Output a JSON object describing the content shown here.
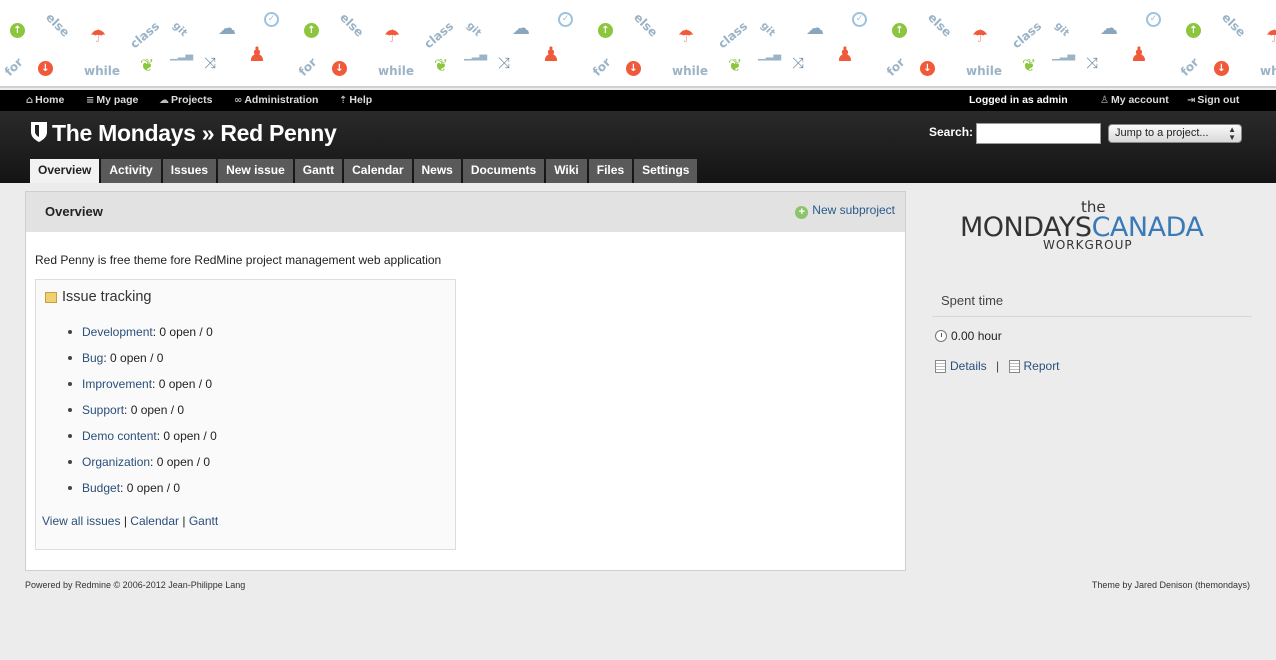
{
  "top_menu": {
    "items": [
      {
        "label": "Home",
        "icon": "home-icon"
      },
      {
        "label": "My page",
        "icon": "list-icon"
      },
      {
        "label": "Projects",
        "icon": "cloud-icon"
      },
      {
        "label": "Administration",
        "icon": "link-icon"
      },
      {
        "label": "Help",
        "icon": "help-icon"
      }
    ],
    "logged_in_prefix": "Logged in as",
    "logged_in_user": "admin",
    "my_account": "My account",
    "sign_out": "Sign out"
  },
  "pattern": {
    "words": [
      "else",
      "class",
      "git",
      "while",
      "for"
    ]
  },
  "header": {
    "title": "The Mondays » Red Penny",
    "search_label": "Search:",
    "search_value": "",
    "jump_label": "Jump to a project..."
  },
  "tabs": [
    {
      "label": "Overview",
      "selected": true
    },
    {
      "label": "Activity"
    },
    {
      "label": "Issues"
    },
    {
      "label": "New issue"
    },
    {
      "label": "Gantt"
    },
    {
      "label": "Calendar"
    },
    {
      "label": "News"
    },
    {
      "label": "Documents"
    },
    {
      "label": "Wiki"
    },
    {
      "label": "Files"
    },
    {
      "label": "Settings"
    }
  ],
  "main": {
    "title": "Overview",
    "new_subproject": "New subproject",
    "description": "Red Penny is free theme fore RedMine project management web application",
    "issue_tracking": {
      "title": "Issue tracking",
      "trackers": [
        {
          "name": "Development",
          "count": ": 0 open / 0"
        },
        {
          "name": "Bug",
          "count": ": 0 open / 0"
        },
        {
          "name": "Improvement",
          "count": ": 0 open / 0"
        },
        {
          "name": "Support",
          "count": ": 0 open / 0"
        },
        {
          "name": "Demo content",
          "count": ": 0 open / 0"
        },
        {
          "name": "Organization",
          "count": ": 0 open / 0"
        },
        {
          "name": "Budget",
          "count": ": 0 open / 0"
        }
      ],
      "view_all": "View all issues",
      "calendar": "Calendar",
      "gantt": "Gantt",
      "separator": "|"
    }
  },
  "sidebar": {
    "logo": {
      "the": "the",
      "mondays": "MONDAYS",
      "canada": "CANADA",
      "workgroup": "WORKGROUP"
    },
    "spent_time_title": "Spent time",
    "hours": "0.00 hour",
    "details": "Details",
    "report": "Report",
    "separator": "|"
  },
  "footer": {
    "left": "Powered by Redmine © 2006-2012 Jean-Philippe Lang",
    "right": "Theme by Jared Denison (themondays)"
  },
  "colors": {
    "accent_red": "#f05a3a",
    "accent_green": "#8cc63f",
    "link_blue": "#2a4f7a",
    "header_black": "#141414"
  }
}
